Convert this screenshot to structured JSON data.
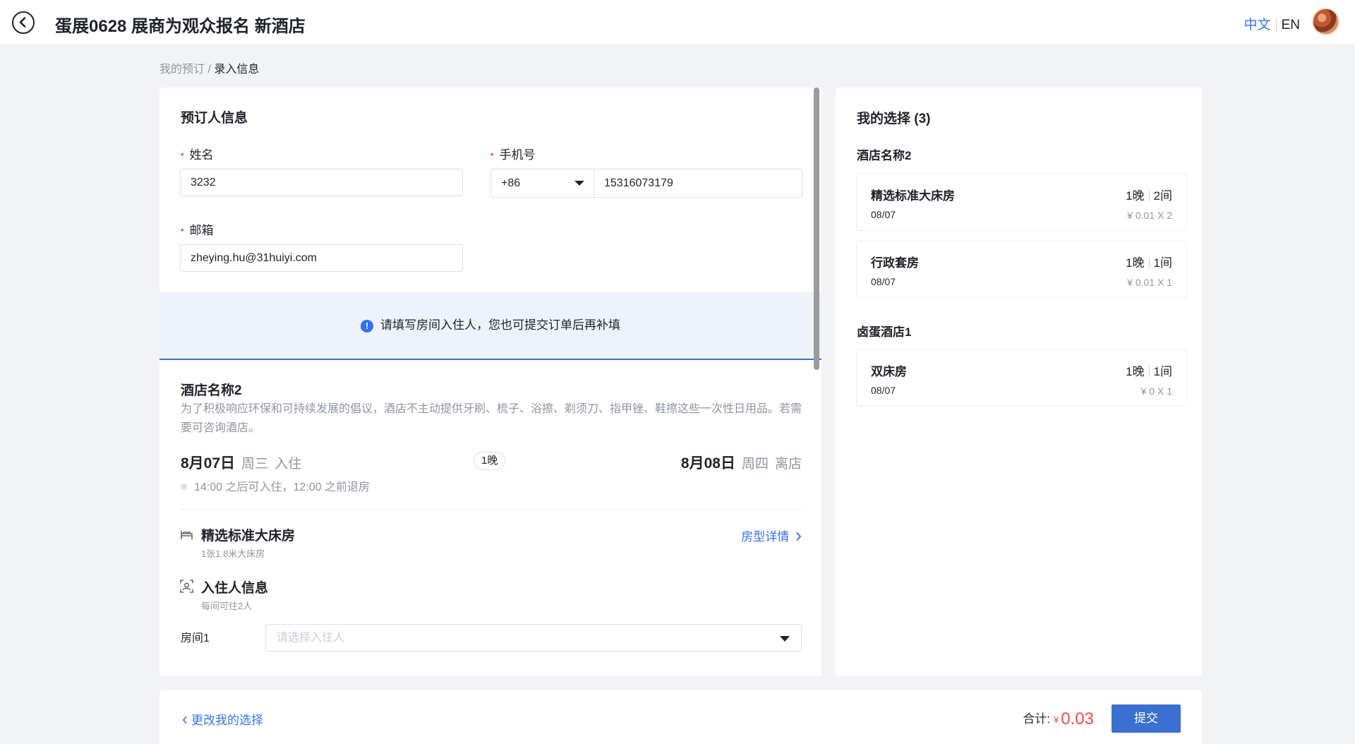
{
  "header": {
    "title": "蛋展0628 展商为观众报名 新酒店",
    "lang_zh": "中文",
    "lang_en": "EN",
    "back_icon": "back-arrow-circle-icon"
  },
  "breadcrumb": {
    "parent": "我的预订",
    "separator": "/",
    "current": "录入信息"
  },
  "booker": {
    "section_title": "预订人信息",
    "name_label": "姓名",
    "name_value": "3232",
    "phone_label": "手机号",
    "phone_prefix": "+86",
    "phone_value": "15316073179",
    "email_label": "邮箱",
    "email_value": "zheying.hu@31huiyi.com",
    "required_mark": "•"
  },
  "notice": {
    "icon": "!",
    "text": "请填写房间入住人，您也可提交订单后再补填"
  },
  "hotel_detail": {
    "name": "酒店名称2",
    "description": "为了积极响应环保和可持续发展的倡议，酒店不主动提供牙刷、梳子、浴擦、剃须刀、指甲锉、鞋擦这些一次性日用品。若需要可咨询酒店。",
    "checkin_date": "8月07日",
    "checkin_weekday": "周三",
    "checkin_label": "入住",
    "nights": "1晚",
    "checkout_date": "8月08日",
    "checkout_weekday": "周四",
    "checkout_label": "离店",
    "time_policy": "14:00 之后可入住，12:00 之前退房",
    "room_type": "精选标准大床房",
    "room_bed": "1张1.8米大床房",
    "room_detail_link": "房型详情",
    "guest_title": "入住人信息",
    "guest_sub": "每间可住2人",
    "room1_label": "房间1",
    "room1_placeholder": "请选择入住人"
  },
  "selection": {
    "title": "我的选择 (3)",
    "hotels": [
      {
        "name": "酒店名称2",
        "rooms": [
          {
            "name": "精选标准大床房",
            "nights": "1晚",
            "count": "2间",
            "date": "08/07",
            "price": "¥ 0.01 X 2"
          },
          {
            "name": "行政套房",
            "nights": "1晚",
            "count": "1间",
            "date": "08/07",
            "price": "¥ 0.01 X 1"
          }
        ]
      },
      {
        "name": "卤蛋酒店1",
        "rooms": [
          {
            "name": "双床房",
            "nights": "1晚",
            "count": "1间",
            "date": "08/07",
            "price": "¥ 0 X 1"
          }
        ]
      }
    ]
  },
  "footer": {
    "change_link": "更改我的选择",
    "total_label": "合计:",
    "currency": "¥",
    "total_amount": "0.03",
    "submit_label": "提交"
  },
  "colors": {
    "accent": "#3370ff",
    "submit_bg": "#3b6fd1",
    "price_red": "#f54a45",
    "page_bg": "#f2f3f5"
  }
}
